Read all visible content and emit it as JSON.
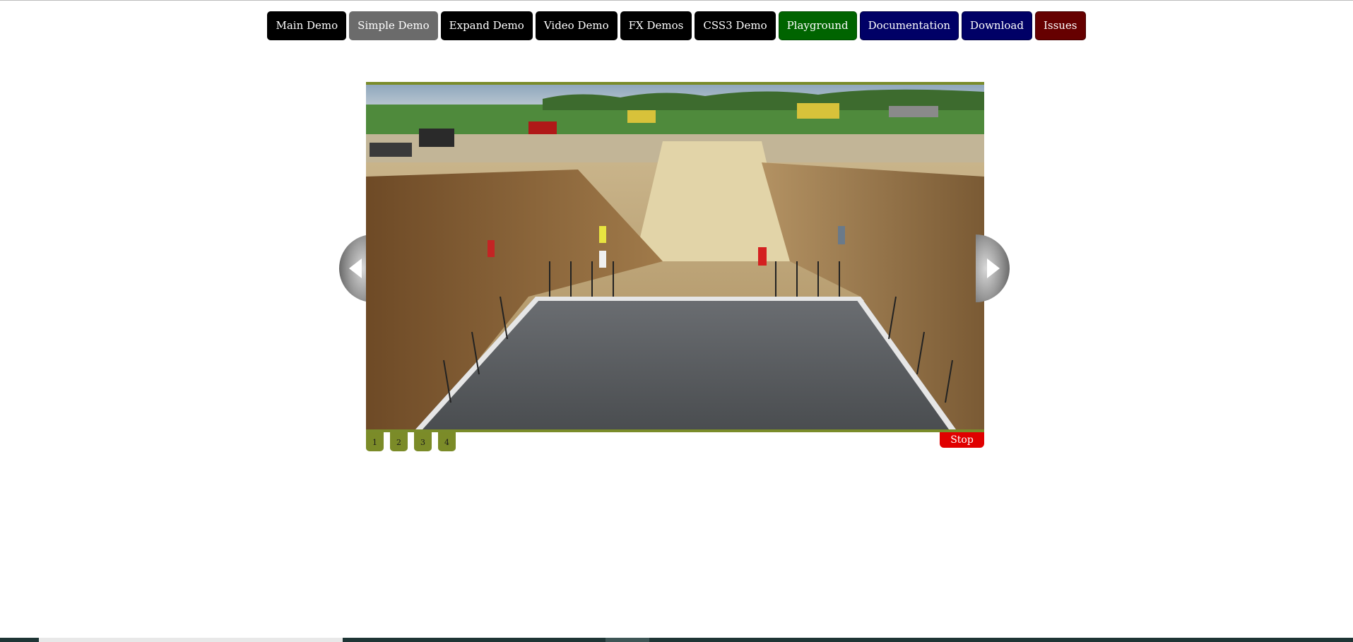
{
  "nav": {
    "buttons": [
      {
        "label": "Main Demo",
        "color": "#000000"
      },
      {
        "label": "Simple Demo",
        "color": "#6b6b6b"
      },
      {
        "label": "Expand Demo",
        "color": "#000000"
      },
      {
        "label": "Video Demo",
        "color": "#000000"
      },
      {
        "label": "FX Demos",
        "color": "#000000"
      },
      {
        "label": "CSS3 Demo",
        "color": "#000000"
      },
      {
        "label": "Playground",
        "color": "#006400"
      },
      {
        "label": "Documentation",
        "color": "#000066"
      },
      {
        "label": "Download",
        "color": "#000066"
      },
      {
        "label": "Issues",
        "color": "#660000"
      }
    ]
  },
  "slider": {
    "accent_color": "#7a8c2a",
    "prev_icon": "arrow-left-icon",
    "next_icon": "arrow-right-icon",
    "pages": [
      "1",
      "2",
      "3",
      "4"
    ],
    "current_page": "1",
    "stop_label": "Stop",
    "stop_color": "#e00000"
  }
}
